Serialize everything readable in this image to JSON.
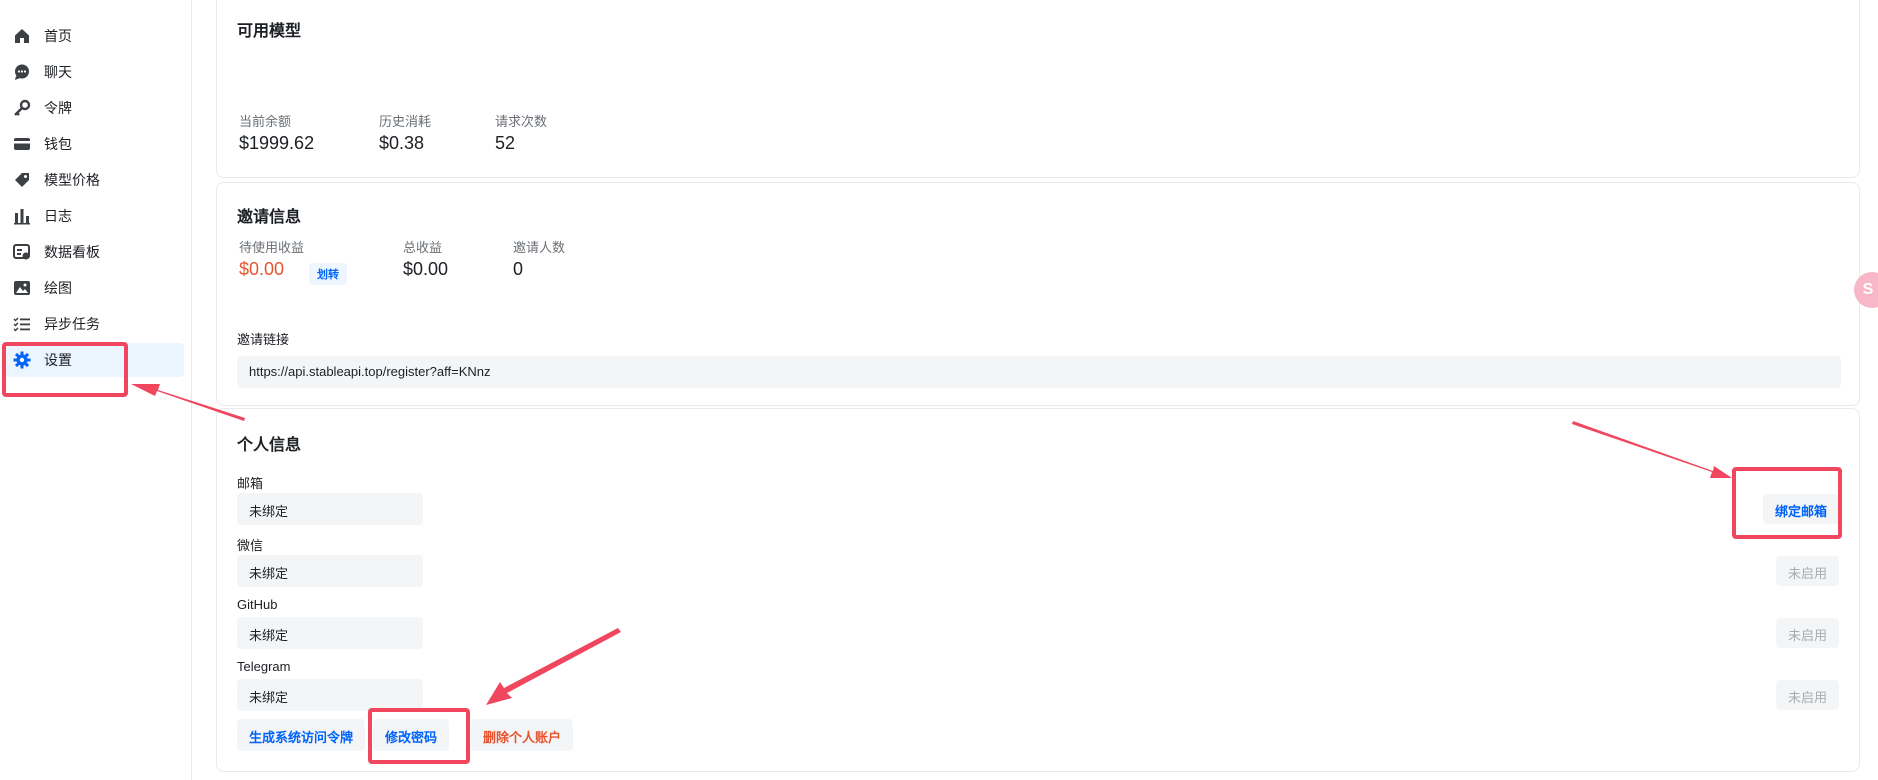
{
  "sidebar": {
    "items": [
      {
        "label": "首页",
        "icon": "home-icon"
      },
      {
        "label": "聊天",
        "icon": "chat-icon"
      },
      {
        "label": "令牌",
        "icon": "key-icon"
      },
      {
        "label": "钱包",
        "icon": "wallet-icon"
      },
      {
        "label": "模型价格",
        "icon": "price-tag-icon"
      },
      {
        "label": "日志",
        "icon": "bar-chart-icon"
      },
      {
        "label": "数据看板",
        "icon": "dashboard-icon"
      },
      {
        "label": "绘图",
        "icon": "image-icon"
      },
      {
        "label": "异步任务",
        "icon": "task-list-icon"
      },
      {
        "label": "设置",
        "icon": "gear-icon",
        "active": true
      }
    ]
  },
  "models_card": {
    "title": "可用模型",
    "stats": [
      {
        "label": "当前余额",
        "value": "$1999.62"
      },
      {
        "label": "历史消耗",
        "value": "$0.38"
      },
      {
        "label": "请求次数",
        "value": "52"
      }
    ]
  },
  "invite_card": {
    "title": "邀请信息",
    "stats": [
      {
        "label": "待使用收益",
        "value": "$0.00"
      },
      {
        "label": "总收益",
        "value": "$0.00"
      },
      {
        "label": "邀请人数",
        "value": "0"
      }
    ],
    "transfer_label": "划转",
    "link_label": "邀请链接",
    "link_value": "https://api.stableapi.top/register?aff=KNnz"
  },
  "personal_card": {
    "title": "个人信息",
    "fields": [
      {
        "label": "邮箱",
        "value": "未绑定",
        "action": "绑定邮箱"
      },
      {
        "label": "微信",
        "value": "未绑定",
        "action": "未启用"
      },
      {
        "label": "GitHub",
        "value": "未绑定",
        "action": "未启用"
      },
      {
        "label": "Telegram",
        "value": "未绑定",
        "action": "未启用"
      }
    ],
    "buttons": {
      "generate_token": "生成系统访问令牌",
      "change_password": "修改密码",
      "delete_account": "删除个人账户"
    }
  },
  "colors": {
    "accent": "#0064fa",
    "danger": "#e8532f",
    "annotation": "#f0465e",
    "active_bg": "#eaf5ff"
  }
}
